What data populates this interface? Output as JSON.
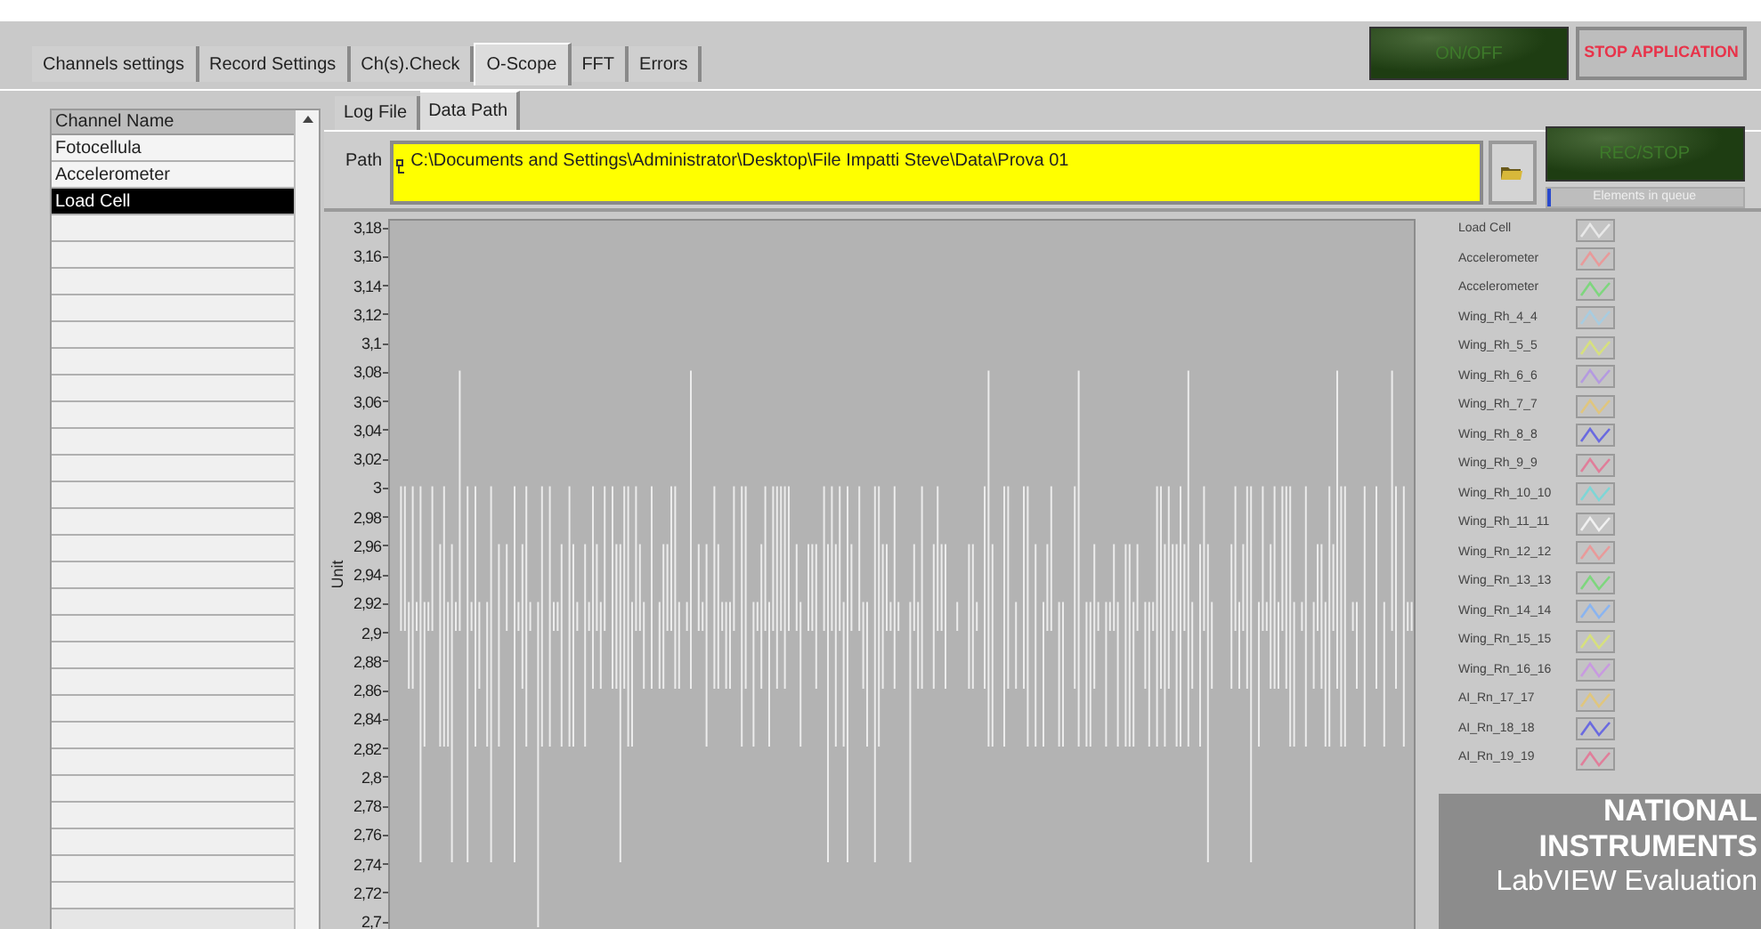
{
  "tabs": [
    {
      "label": "Channels settings",
      "selected": false
    },
    {
      "label": "Record Settings",
      "selected": false
    },
    {
      "label": "Ch(s).Check",
      "selected": false
    },
    {
      "label": "O-Scope",
      "selected": true
    },
    {
      "label": "FFT",
      "selected": false
    },
    {
      "label": "Errors",
      "selected": false
    }
  ],
  "on_off_button": {
    "label": "ON/OFF",
    "on": false
  },
  "stop_button": {
    "label": "STOP APPLICATION"
  },
  "channel_list": {
    "header": "Channel Name",
    "rows": [
      {
        "label": "Fotocellula",
        "selected": false
      },
      {
        "label": "Accelerometer",
        "selected": false
      },
      {
        "label": "Load Cell",
        "selected": true
      }
    ]
  },
  "subtabs": [
    {
      "label": "Log File",
      "selected": false
    },
    {
      "label": "Data Path",
      "selected": true
    }
  ],
  "path": {
    "label": "Path",
    "value": "C:\\Documents and Settings\\Administrator\\Desktop\\File Impatti Steve\\Data\\Prova 01"
  },
  "rec_button": {
    "label": "REC/STOP",
    "on": false
  },
  "queue_indicator": {
    "label": "Elements in queue",
    "level": 0.02
  },
  "graph": {
    "ylabel": "Unit",
    "yticks": [
      "3,18",
      "3,16",
      "3,14",
      "3,12",
      "3,1",
      "3,08",
      "3,06",
      "3,04",
      "3,02",
      "3",
      "2,98",
      "2,96",
      "2,94",
      "2,92",
      "2,9",
      "2,88",
      "2,86",
      "2,84",
      "2,82",
      "2,8",
      "2,78",
      "2,76",
      "2,74",
      "2,72",
      "2,7"
    ]
  },
  "legend": [
    {
      "label": "Load Cell",
      "color": "#e8e8e8"
    },
    {
      "label": "Accelerometer",
      "color": "#e89a9a"
    },
    {
      "label": "Accelerometer",
      "color": "#7ed67e"
    },
    {
      "label": "Wing_Rh_4_4",
      "color": "#a8cce0"
    },
    {
      "label": "Wing_Rh_5_5",
      "color": "#d6e07e"
    },
    {
      "label": "Wing_Rh_6_6",
      "color": "#b49ae0"
    },
    {
      "label": "Wing_Rh_7_7",
      "color": "#e0c67e"
    },
    {
      "label": "Wing_Rh_8_8",
      "color": "#6a6ae0"
    },
    {
      "label": "Wing_Rh_9_9",
      "color": "#e07e9a"
    },
    {
      "label": "Wing_Rh_10_10",
      "color": "#7ed6d6"
    },
    {
      "label": "Wing_Rh_11_11",
      "color": "#f0f0f0"
    },
    {
      "label": "Wing_Rn_12_12",
      "color": "#e89a9a"
    },
    {
      "label": "Wing_Rn_13_13",
      "color": "#7ed67e"
    },
    {
      "label": "Wing_Rn_14_14",
      "color": "#8ab4f0"
    },
    {
      "label": "Wing_Rn_15_15",
      "color": "#d6e07e"
    },
    {
      "label": "Wing_Rn_16_16",
      "color": "#c89ae0"
    },
    {
      "label": "AI_Rn_17_17",
      "color": "#e0c67e"
    },
    {
      "label": "AI_Rn_18_18",
      "color": "#6a6ae0"
    },
    {
      "label": "AI_Rn_19_19",
      "color": "#e07e9a"
    }
  ],
  "watermark": [
    "NATIONAL",
    "INSTRUMENTS",
    "LabVIEW Evaluation"
  ]
}
